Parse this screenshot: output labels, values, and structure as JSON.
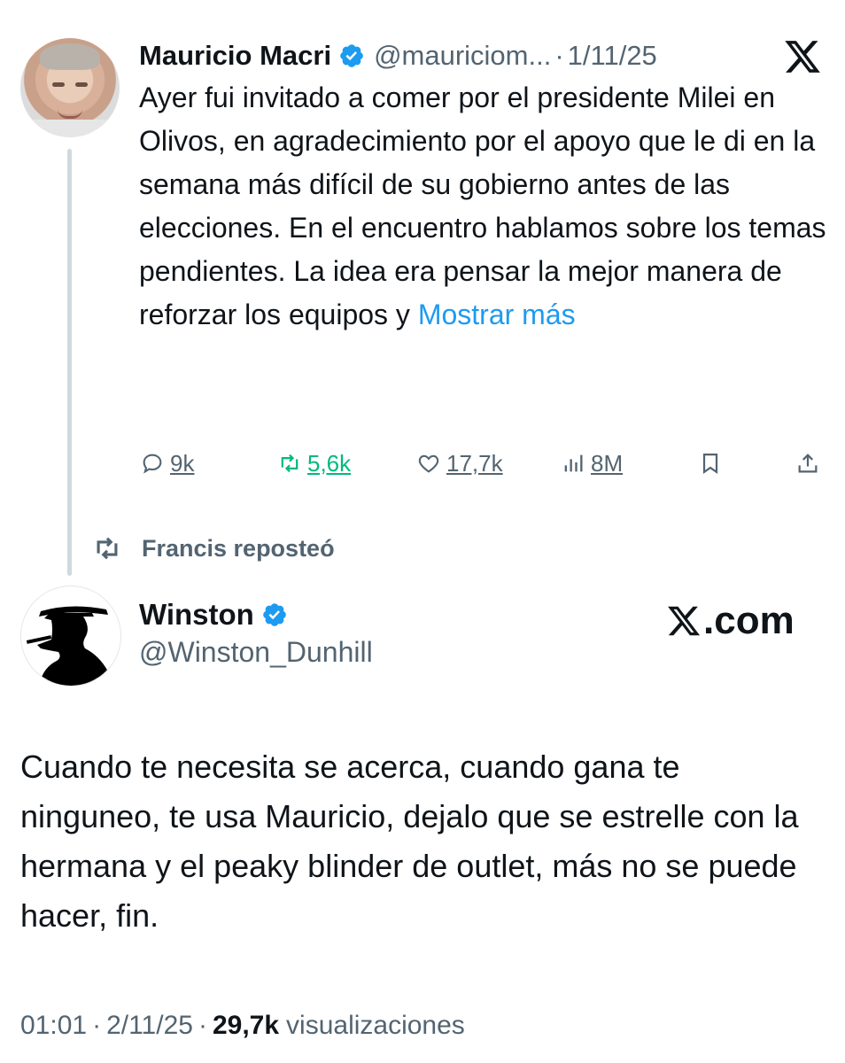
{
  "quoted_tweet": {
    "author_name": "Mauricio Macri",
    "handle": "@mauriciom...",
    "separator": "·",
    "date": "1/11/25",
    "text": "Ayer fui invitado a comer por el presidente Milei en Olivos, en agradecimiento por el apoyo que le di en la semana más difícil de su gobierno antes de las elecciones. En el encuentro hablamos sobre los temas pendientes. La idea era pensar la mejor manera de reforzar los equipos y ",
    "show_more": "Mostrar más",
    "replies": "9k",
    "reposts": "5,6k",
    "likes": "17,7k",
    "views": "8M",
    "icons": [
      "verified-badge-icon",
      "x-logo-icon",
      "reply-icon",
      "repost-icon",
      "like-icon",
      "views-icon",
      "bookmark-icon",
      "share-icon"
    ]
  },
  "repost_banner": {
    "text": "Francis reposteó"
  },
  "main_tweet": {
    "author_name": "Winston",
    "handle": "@Winston_Dunhill",
    "watermark": ".com",
    "text": "Cuando te necesita se acerca, cuando gana te ninguneo, te usa Mauricio, dejalo que se estrelle con la hermana y el peaky blinder de outlet, más no se puede hacer, fin.",
    "time": "01:01",
    "separator": "·",
    "date": "2/11/25",
    "views_count": "29,7k",
    "views_label": "visualizaciones"
  },
  "colors": {
    "accent": "#1d9bf0",
    "repost_green": "#00ba7c",
    "muted": "#536471",
    "text": "#0f1419"
  }
}
